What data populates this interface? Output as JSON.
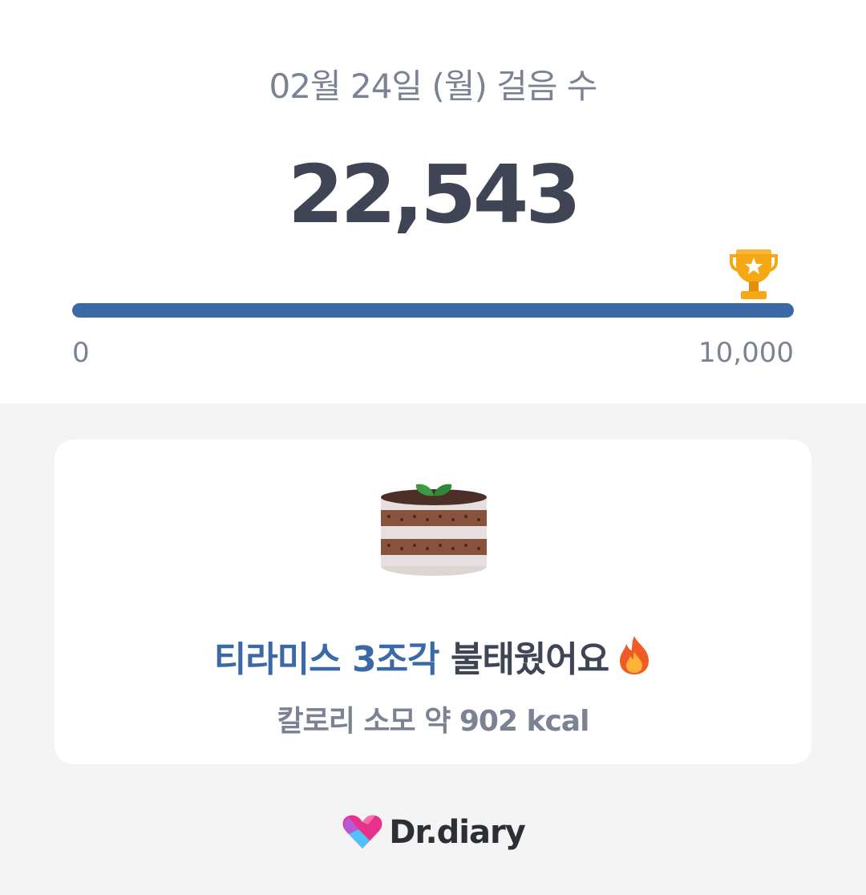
{
  "header": {
    "date_title": "02월 24일 (월) 걸음 수",
    "step_count": "22,543"
  },
  "progress": {
    "min_label": "0",
    "max_label": "10,000",
    "fill_fraction": 1.0,
    "goal_icon": "trophy-icon",
    "fill_color": "#3b69a6"
  },
  "burn_card": {
    "food_icon": "cake-icon",
    "highlight_text": "티라미스 3조각",
    "rest_text": " 불태웠어요",
    "emoji_icon": "fire-icon",
    "calorie_text": "칼로리 소모 약 902 kcal"
  },
  "brand": {
    "logo_icon": "heart-logo-icon",
    "name": "Dr.diary"
  },
  "colors": {
    "accent": "#3b69a6",
    "text_dark": "#3f4555",
    "text_muted": "#7b8294"
  }
}
